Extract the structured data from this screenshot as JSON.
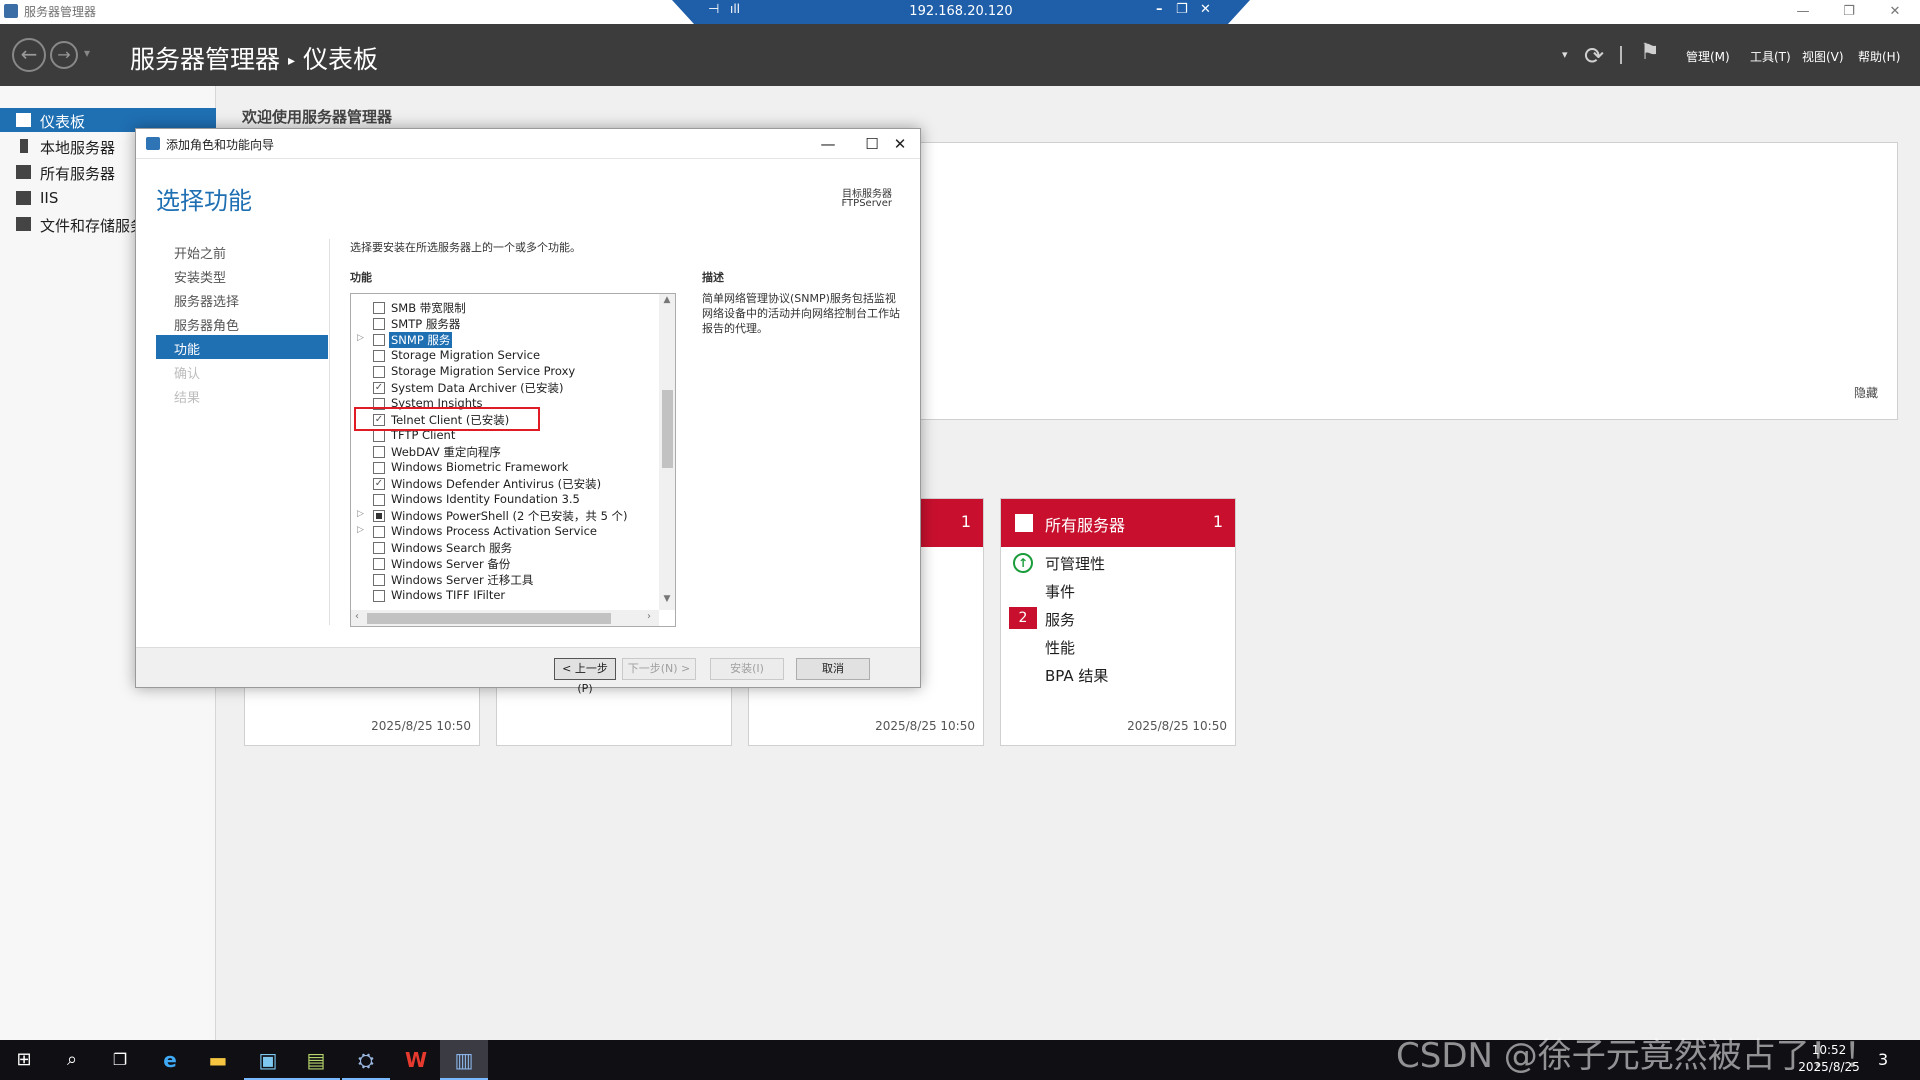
{
  "window": {
    "title": "服务器管理器",
    "minimize": "—",
    "restore": "❐",
    "close": "✕"
  },
  "remote_bar": {
    "ip": "192.168.20.120",
    "pin": "⊣",
    "signal": "ıll",
    "minimize": "–",
    "restore": "❐",
    "close": "✕",
    "color": "#1f5ea8"
  },
  "header": {
    "back": "←",
    "forward": "→",
    "dropdown": "▾",
    "breadcrumb_root": "服务器管理器",
    "breadcrumb_sep": "▸",
    "breadcrumb_page": "仪表板",
    "refresh_icon": "⟳",
    "flag_icon": "⚑",
    "menus": [
      "管理(M)",
      "工具(T)",
      "视图(V)",
      "帮助(H)"
    ]
  },
  "sidebar": {
    "items": [
      {
        "label": "仪表板",
        "icon": "dashboard-icon",
        "active": true
      },
      {
        "label": "本地服务器",
        "icon": "local-server-icon"
      },
      {
        "label": "所有服务器",
        "icon": "all-servers-icon"
      },
      {
        "label": "IIS",
        "icon": "iis-icon"
      },
      {
        "label": "文件和存储服务",
        "icon": "file-storage-icon"
      }
    ]
  },
  "dashboard": {
    "welcome_title": "欢迎使用服务器管理器",
    "hide_link": "隐藏",
    "tiles": [
      {
        "timestamp": "2025/8/25 10:50"
      },
      {
        "timestamp": ""
      },
      {
        "count": "1",
        "timestamp": "2025/8/25 10:50"
      },
      {
        "title": "所有服务器",
        "count": "1",
        "rows": [
          "可管理性",
          "事件",
          "服务",
          "性能",
          "BPA 结果"
        ],
        "services_badge": "2",
        "ok_icon": "↑",
        "timestamp": "2025/8/25 10:50"
      }
    ]
  },
  "wizard": {
    "title": "添加角色和功能向导",
    "minimize": "—",
    "maximize": "☐",
    "close": "✕",
    "heading": "选择功能",
    "destination_label": "目标服务器",
    "destination_value": "FTPServer",
    "steps": [
      {
        "label": "开始之前",
        "state": "normal"
      },
      {
        "label": "安装类型",
        "state": "normal"
      },
      {
        "label": "服务器选择",
        "state": "normal"
      },
      {
        "label": "服务器角色",
        "state": "normal"
      },
      {
        "label": "功能",
        "state": "current"
      },
      {
        "label": "确认",
        "state": "disabled"
      },
      {
        "label": "结果",
        "state": "disabled"
      }
    ],
    "instruction": "选择要安装在所选服务器上的一个或多个功能。",
    "features_label": "功能",
    "description_label": "描述",
    "description_text": "简单网络管理协议(SNMP)服务包括监视网络设备中的活动并向网络控制台工作站报告的代理。",
    "features": [
      {
        "label": "SMB 带宽限制",
        "checked": false
      },
      {
        "label": "SMTP 服务器",
        "checked": false
      },
      {
        "label": "SNMP 服务",
        "checked": false,
        "expandable": true,
        "selected": true
      },
      {
        "label": "Storage Migration Service",
        "checked": false
      },
      {
        "label": "Storage Migration Service Proxy",
        "checked": false
      },
      {
        "label": "System Data Archiver (已安装)",
        "checked": true
      },
      {
        "label": "System Insights",
        "checked": false
      },
      {
        "label": "Telnet Client (已安装)",
        "checked": true
      },
      {
        "label": "TFTP Client",
        "checked": false
      },
      {
        "label": "WebDAV 重定向程序",
        "checked": false
      },
      {
        "label": "Windows Biometric Framework",
        "checked": false
      },
      {
        "label": "Windows Defender Antivirus (已安装)",
        "checked": true
      },
      {
        "label": "Windows Identity Foundation 3.5",
        "checked": false
      },
      {
        "label": "Windows PowerShell (2 个已安装，共 5 个)",
        "partial": true,
        "expandable": true
      },
      {
        "label": "Windows Process Activation Service",
        "checked": false,
        "expandable": true
      },
      {
        "label": "Windows Search 服务",
        "checked": false
      },
      {
        "label": "Windows Server 备份",
        "checked": false
      },
      {
        "label": "Windows Server 迁移工具",
        "checked": false
      },
      {
        "label": "Windows TIFF IFilter",
        "checked": false
      }
    ],
    "buttons": {
      "prev": "< 上一步(P)",
      "next": "下一步(N) >",
      "install": "安装(I)",
      "cancel": "取消"
    }
  },
  "taskbar": {
    "items": [
      "windows-start-icon",
      "search-icon",
      "task-view-icon",
      "internet-explorer-icon",
      "file-explorer-icon",
      "remote-desktop-icon",
      "server-app-icon",
      "network-app-icon",
      "wps-icon",
      "server-manager-icon"
    ],
    "watermark": "CSDN @徐子元竟然被占了！！",
    "time": "10:52",
    "date": "2025/8/25",
    "notifications": "3"
  },
  "colors": {
    "accent_blue": "#1f6fb3",
    "alert_red": "#c8102e",
    "header_dark": "#3c3c3c",
    "highlight_red": "#e01b24"
  }
}
